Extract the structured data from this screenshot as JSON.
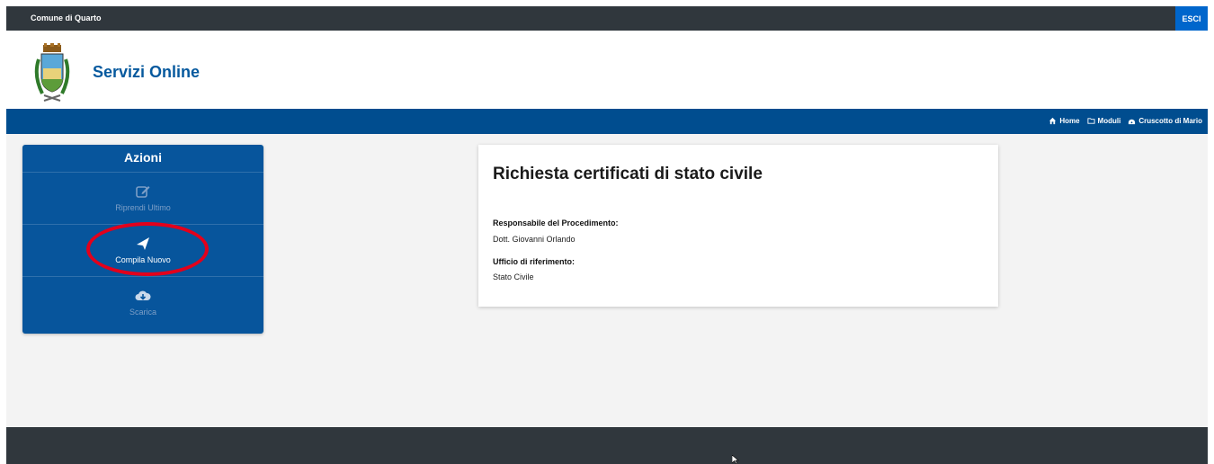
{
  "topbar": {
    "org_name": "Comune di Quarto",
    "logout_label": "ESCI"
  },
  "header": {
    "site_title": "Servizi Online",
    "logo_icon": "coat-of-arms-icon"
  },
  "nav": {
    "links": [
      {
        "label": "Home",
        "icon": "home-icon"
      },
      {
        "label": "Moduli",
        "icon": "folder-open-icon"
      },
      {
        "label": "Cruscotto di Mario",
        "icon": "dashboard-icon"
      }
    ]
  },
  "actions": {
    "title": "Azioni",
    "items": [
      {
        "label": "Riprendi Ultimo",
        "icon": "edit-icon",
        "enabled": false
      },
      {
        "label": "Compila Nuovo",
        "icon": "paper-plane-icon",
        "enabled": true
      },
      {
        "label": "Scarica",
        "icon": "cloud-download-icon",
        "enabled": false
      }
    ]
  },
  "card": {
    "title": "Richiesta certificati di stato civile",
    "responsible_label": "Responsabile del Procedimento:",
    "responsible_value": "Dott. Giovanni Orlando",
    "office_label": "Ufficio di riferimento:",
    "office_value": "Stato Civile"
  },
  "colors": {
    "brand_blue": "#004d8f",
    "panel_blue": "#07559c",
    "dark_bar": "#30373d",
    "logout_blue": "#0066cc",
    "highlight_red": "#e3001b"
  }
}
